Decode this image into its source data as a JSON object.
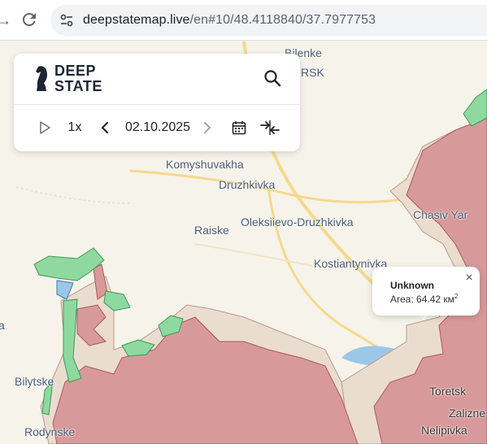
{
  "browser": {
    "url_host": "deepstatemap.live",
    "url_path": "/en#10/48.4118840/37.7977753"
  },
  "panel": {
    "logo_line1": "DEEP",
    "logo_line2": "STATE",
    "speed": "1x",
    "date": "02.10.2025"
  },
  "map": {
    "places": [
      {
        "name": "Bilenke"
      },
      {
        "name": "RSK"
      },
      {
        "name": "Komyshuvakha"
      },
      {
        "name": "Druzhkivka"
      },
      {
        "name": "Raiske"
      },
      {
        "name": "Oleksiievo-Druzhkivka"
      },
      {
        "name": "Chasiv Yar"
      },
      {
        "name": "Kostiantynivka"
      },
      {
        "name": "Bilytske"
      },
      {
        "name": "Toretsk"
      },
      {
        "name": "Zalizne"
      },
      {
        "name": "Rodynske"
      },
      {
        "name": "Nelipivka"
      },
      {
        "name": "a"
      }
    ],
    "colors": {
      "occupied": "#d8999a",
      "contested": "#ebdcd0",
      "liberated": "#8fd9a0",
      "water": "#9cc8e8",
      "road": "#f5d98c"
    }
  },
  "popup": {
    "title": "Unknown",
    "area_label": "Area: 64.42 км",
    "area_unit_sup": "2"
  }
}
